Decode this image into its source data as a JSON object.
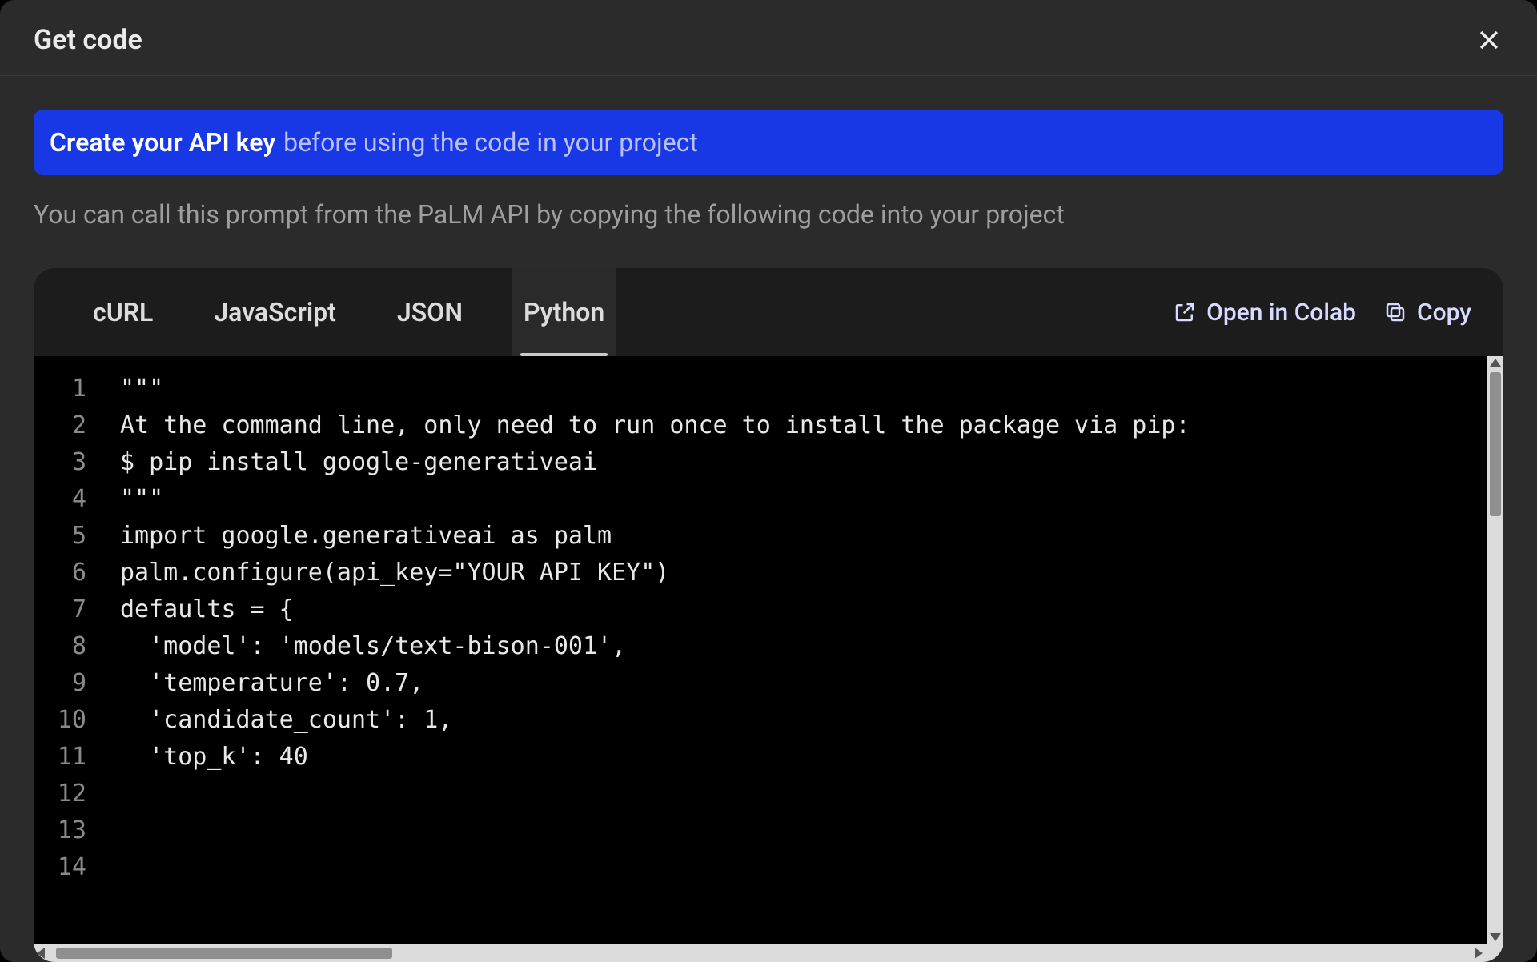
{
  "dialog": {
    "title": "Get code"
  },
  "banner": {
    "link_text": "Create your API key",
    "tail_text": " before using the code in your project"
  },
  "subtitle": "You can call this prompt from the PaLM API by copying the following code into your project",
  "tabs": {
    "items": [
      {
        "label": "cURL",
        "active": false
      },
      {
        "label": "JavaScript",
        "active": false
      },
      {
        "label": "JSON",
        "active": false
      },
      {
        "label": "Python",
        "active": true
      }
    ]
  },
  "actions": {
    "open_colab": "Open in Colab",
    "copy": "Copy"
  },
  "code": {
    "line_numbers": [
      "1",
      "2",
      "3",
      "4",
      "5",
      "6",
      "7",
      "8",
      "9",
      "10",
      "11",
      "12",
      "13",
      "14"
    ],
    "lines": [
      "\"\"\"",
      "At the command line, only need to run once to install the package via pip:",
      "",
      "$ pip install google-generativeai",
      "\"\"\"",
      "",
      "import google.generativeai as palm",
      "palm.configure(api_key=\"YOUR API KEY\")",
      "",
      "defaults = {",
      "  'model': 'models/text-bison-001',",
      "  'temperature': 0.7,",
      "  'candidate_count': 1,",
      "  'top_k': 40"
    ]
  }
}
